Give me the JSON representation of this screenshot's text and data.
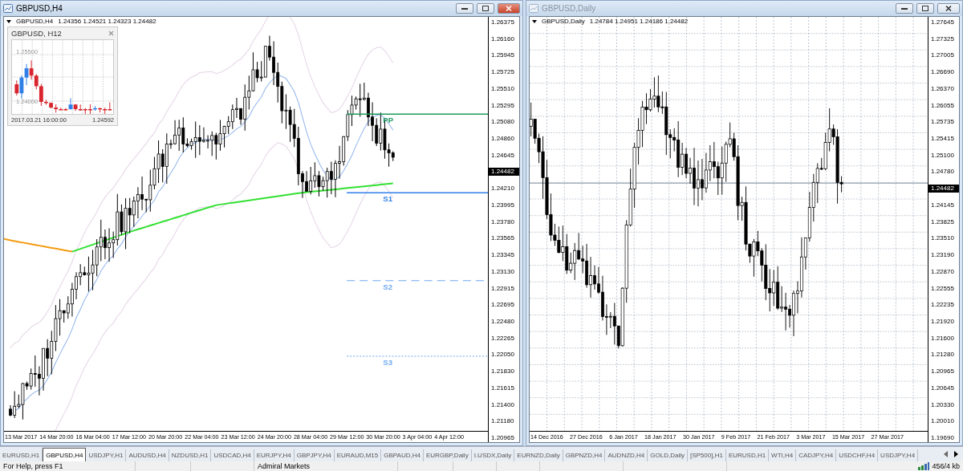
{
  "windows": [
    {
      "title": "GBPUSD,H4",
      "active": true,
      "grid": false,
      "info_symbol": "GBPUSD,H4",
      "info_prices": "1.24356 1.24521 1.24323 1.24482",
      "price_axis": {
        "ticks_above": [
          "1.26375",
          "1.26160",
          "1.25945",
          "1.25725",
          "1.25510",
          "1.25295",
          "1.25080",
          "1.24860",
          "1.24645"
        ],
        "current_price": "1.24482",
        "ticks_below": [
          "1.24210",
          "1.23995",
          "1.23780",
          "1.23565",
          "1.23345",
          "1.23130",
          "1.22915",
          "1.22695",
          "1.22480",
          "1.22265",
          "1.22050",
          "1.21830",
          "1.21615",
          "1.21400",
          "1.21180",
          "1.20965"
        ]
      },
      "time_axis": [
        "13 Mar 2017",
        "14 Mar 20:00",
        "16 Mar 04:00",
        "17 Mar 12:00",
        "20 Mar 20:00",
        "22 Mar 04:00",
        "23 Mar 12:00",
        "24 Mar 20:00",
        "28 Mar 04:00",
        "29 Mar 12:00",
        "30 Mar 20:00",
        "3 Apr 04:00",
        "4 Apr 12:00"
      ],
      "levels": [
        {
          "label": "PP",
          "kind": "solid",
          "color": "#1f9a5a"
        },
        {
          "label": "S1",
          "kind": "solid",
          "color": "#2f7fe8"
        },
        {
          "label": "S2",
          "kind": "dashed",
          "color": "#6fa8f0"
        },
        {
          "label": "S3",
          "kind": "dotted",
          "color": "#6fa8f0"
        }
      ],
      "inset": {
        "title": "GBPUSD, H12",
        "labels": [
          "1.25500",
          "1.24000"
        ],
        "time": "2017.03.21 16:00:00",
        "price": "1.24592"
      }
    },
    {
      "title": "GBPUSD,Daily",
      "active": false,
      "grid": true,
      "info_symbol": "GBPUSD,Daily",
      "info_prices": "1.24784 1.24951 1.24186 1.24482",
      "price_axis": {
        "ticks_above": [
          "1.27645",
          "1.27325",
          "1.27005",
          "1.26690",
          "1.26370",
          "1.26055",
          "1.25735",
          "1.25415",
          "1.25100",
          "1.24780"
        ],
        "current_price": "1.24482",
        "ticks_below": [
          "1.24145",
          "1.23825",
          "1.23510",
          "1.23190",
          "1.22870",
          "1.22555",
          "1.22235",
          "1.21920",
          "1.21600",
          "1.21280",
          "1.20965",
          "1.20645",
          "1.20330",
          "1.20010",
          "1.19690"
        ]
      },
      "time_axis": [
        "14 Dec 2016",
        "27 Dec 2016",
        "6 Jan 2017",
        "18 Jan 2017",
        "30 Jan 2017",
        "9 Feb 2017",
        "21 Feb 2017",
        "3 Mar 2017",
        "15 Mar 2017",
        "27 Mar 2017"
      ]
    }
  ],
  "tabs": [
    {
      "label": "EURUSD,H1",
      "selected": false
    },
    {
      "label": "GBPUSD,H4",
      "selected": true
    },
    {
      "label": "USDJPY,H1",
      "selected": false
    },
    {
      "label": "AUDUSD,H4",
      "selected": false
    },
    {
      "label": "NZDUSD,H1",
      "selected": false
    },
    {
      "label": "USDCAD,H4",
      "selected": false
    },
    {
      "label": "EURJPY,H4",
      "selected": false
    },
    {
      "label": "GBPJPY,H4",
      "selected": false
    },
    {
      "label": "EURAUD,M15",
      "selected": false
    },
    {
      "label": "GBPAUD,H4",
      "selected": false
    },
    {
      "label": "EURGBP,Daily",
      "selected": false
    },
    {
      "label": "I.USDX,Daily",
      "selected": false
    },
    {
      "label": "EURNZD,Daily",
      "selected": false
    },
    {
      "label": "GBPNZD,H4",
      "selected": false
    },
    {
      "label": "AUDNZD,H4",
      "selected": false
    },
    {
      "label": "GOLD,Daily",
      "selected": false
    },
    {
      "label": "[SP500],H1",
      "selected": false
    },
    {
      "label": "EURUSD,H1",
      "selected": false
    },
    {
      "label": "WTI,H4",
      "selected": false
    },
    {
      "label": "CADJPY,H4",
      "selected": false
    },
    {
      "label": "USDCHF,H4",
      "selected": false
    },
    {
      "label": "USDJPY,H4",
      "selected": false
    }
  ],
  "status_bar": {
    "help": "For Help, press F1",
    "broker": "Admiral Markets",
    "traffic": "456/4 kb"
  }
}
